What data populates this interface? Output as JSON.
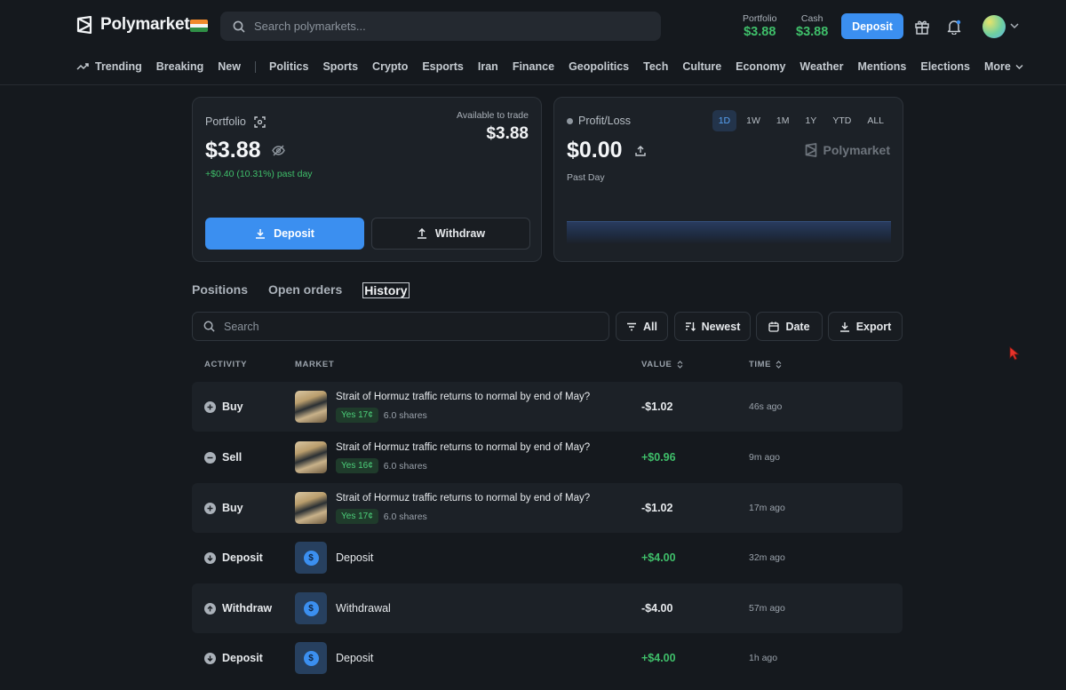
{
  "header": {
    "brand": "Polymarket",
    "search_placeholder": "Search polymarkets...",
    "portfolio_label": "Portfolio",
    "portfolio_value": "$3.88",
    "cash_label": "Cash",
    "cash_value": "$3.88",
    "deposit_label": "Deposit"
  },
  "nav": {
    "primary": [
      "Trending",
      "Breaking",
      "New"
    ],
    "categories": [
      "Politics",
      "Sports",
      "Crypto",
      "Esports",
      "Iran",
      "Finance",
      "Geopolitics",
      "Tech",
      "Culture",
      "Economy",
      "Weather",
      "Mentions",
      "Elections"
    ],
    "more": "More"
  },
  "portfolio": {
    "label": "Portfolio",
    "value": "$3.88",
    "change": "+$0.40 (10.31%) past day",
    "available_label": "Available to trade",
    "available_value": "$3.88",
    "deposit": "Deposit",
    "withdraw": "Withdraw"
  },
  "pl": {
    "label": "Profit/Loss",
    "ranges": [
      "1D",
      "1W",
      "1M",
      "1Y",
      "YTD",
      "ALL"
    ],
    "active_range": "1D",
    "value": "$0.00",
    "period": "Past Day",
    "brand": "Polymarket"
  },
  "tabs": [
    "Positions",
    "Open orders",
    "History"
  ],
  "active_tab": "History",
  "filters": {
    "search_placeholder": "Search",
    "all": "All",
    "sort": "Newest",
    "date": "Date",
    "export": "Export"
  },
  "table": {
    "headers": {
      "activity": "ACTIVITY",
      "market": "MARKET",
      "value": "VALUE",
      "time": "TIME"
    },
    "rows": [
      {
        "activity": "Buy",
        "kind": "trade",
        "title": "Strait of Hormuz traffic returns to normal by end of May?",
        "badge": "Yes 17¢",
        "shares": "6.0 shares",
        "value": "-$1.02",
        "sign": "neg",
        "time": "46s ago"
      },
      {
        "activity": "Sell",
        "kind": "trade",
        "title": "Strait of Hormuz traffic returns to normal by end of May?",
        "badge": "Yes 16¢",
        "shares": "6.0 shares",
        "value": "+$0.96",
        "sign": "pos",
        "time": "9m ago"
      },
      {
        "activity": "Buy",
        "kind": "trade",
        "title": "Strait of Hormuz traffic returns to normal by end of May?",
        "badge": "Yes 17¢",
        "shares": "6.0 shares",
        "value": "-$1.02",
        "sign": "neg",
        "time": "17m ago"
      },
      {
        "activity": "Deposit",
        "kind": "cash",
        "title": "Deposit",
        "value": "+$4.00",
        "sign": "pos",
        "time": "32m ago"
      },
      {
        "activity": "Withdraw",
        "kind": "cash",
        "title": "Withdrawal",
        "value": "-$4.00",
        "sign": "neg",
        "time": "57m ago"
      },
      {
        "activity": "Deposit",
        "kind": "cash",
        "title": "Deposit",
        "value": "+$4.00",
        "sign": "pos",
        "time": "1h ago"
      }
    ]
  },
  "colors": {
    "accent": "#3b8ff0",
    "positive": "#3fbf6a",
    "background": "#15191e"
  }
}
